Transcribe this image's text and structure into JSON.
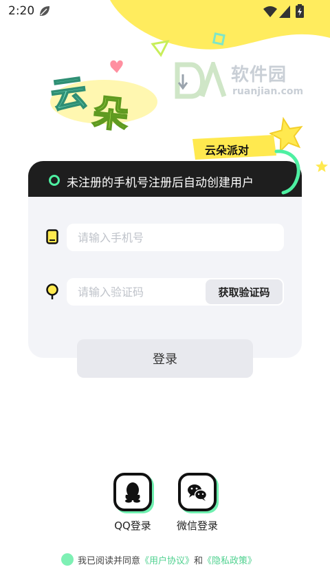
{
  "status_bar": {
    "time": "2:20"
  },
  "logo": {
    "text": "云朵"
  },
  "watermark": {
    "cn": "软件园",
    "en": "ruanjian.com"
  },
  "party_tag": {
    "label": "云朵派对"
  },
  "card": {
    "notice": "未注册的手机号注册后自动创建用户",
    "phone_placeholder": "请输入手机号",
    "phone_value": "",
    "code_placeholder": "请输入验证码",
    "code_value": "",
    "get_code_label": "获取验证码"
  },
  "login": {
    "label": "登录"
  },
  "social": {
    "qq_label": "QQ登录",
    "wechat_label": "微信登录"
  },
  "agreement": {
    "prefix": "我已阅读并同意",
    "user_agreement": "《用户协议》",
    "and": "和",
    "privacy_policy": "《隐私政策》"
  },
  "colors": {
    "accent_green": "#4ef0a2",
    "brand_yellow": "#ffe95c",
    "header_dark": "#1e1e1e"
  }
}
